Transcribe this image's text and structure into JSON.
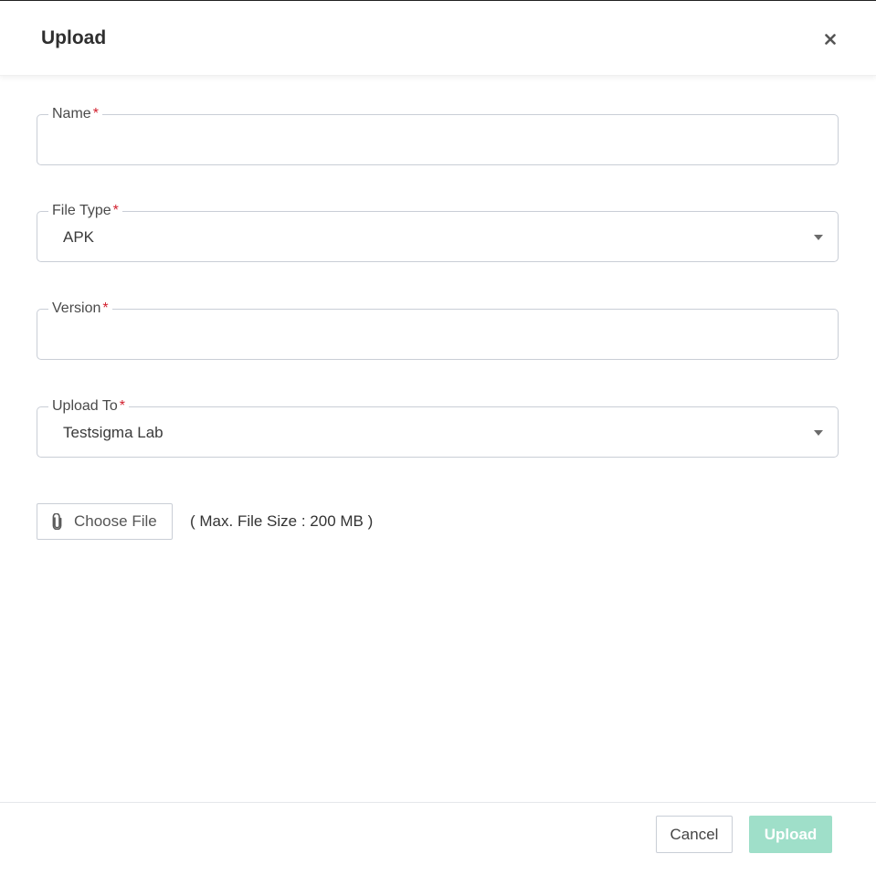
{
  "dialog": {
    "title": "Upload",
    "close_icon": "close-icon"
  },
  "form": {
    "name": {
      "label": "Name",
      "required_mark": "*",
      "value": ""
    },
    "file_type": {
      "label": "File Type",
      "required_mark": "*",
      "selected": "APK",
      "icon": "chevron-down-icon"
    },
    "version": {
      "label": "Version",
      "required_mark": "*",
      "value": ""
    },
    "upload_to": {
      "label": "Upload To",
      "required_mark": "*",
      "selected": "Testsigma Lab",
      "icon": "chevron-down-icon"
    },
    "choose_file": {
      "label": "Choose File",
      "icon": "paperclip-icon"
    },
    "max_size_note": "( Max. File Size : 200 MB )"
  },
  "footer": {
    "cancel_label": "Cancel",
    "upload_label": "Upload"
  },
  "colors": {
    "required": "#d2202e",
    "primary_disabled": "#9fdfc9",
    "border": "#c9ced6"
  }
}
